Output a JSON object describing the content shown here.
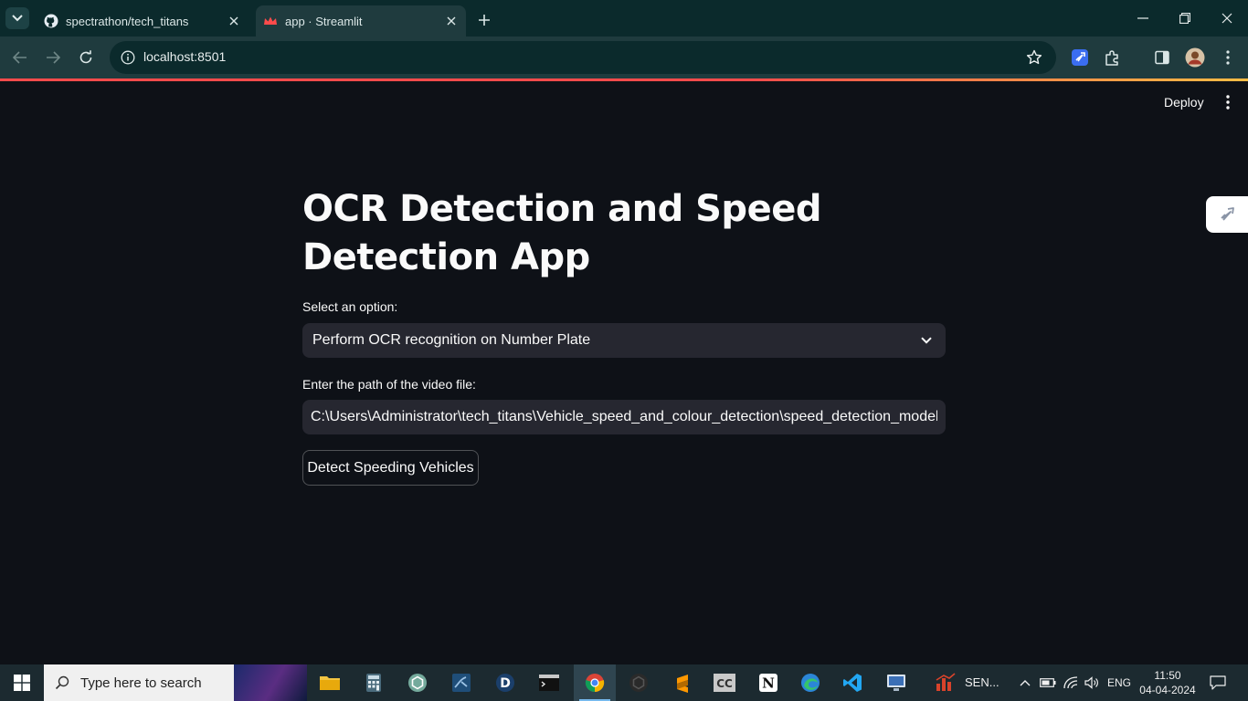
{
  "browser": {
    "tabs": [
      {
        "title": "spectrathon/tech_titans",
        "favicon": "github-icon",
        "active": false
      },
      {
        "title": "app · Streamlit",
        "favicon": "streamlit-icon",
        "active": true
      }
    ],
    "url": "localhost:8501"
  },
  "app": {
    "header": {
      "deploy_label": "Deploy"
    },
    "title": "OCR Detection and Speed Detection App",
    "select": {
      "label": "Select an option:",
      "value": "Perform OCR recognition on Number Plate"
    },
    "video_path": {
      "label": "Enter the path of the video file:",
      "value": "C:\\Users\\Administrator\\tech_titans\\Vehicle_speed_and_colour_detection\\speed_detection_model\\car"
    },
    "detect_button": "Detect Speeding Vehicles"
  },
  "taskbar": {
    "search_placeholder": "Type here to search",
    "pinned_label": "SEN...",
    "language": "ENG",
    "time": "11:50",
    "date": "04-04-2024"
  },
  "colors": {
    "tab_strip": "#0b2a2c",
    "toolbar": "#1f3b3e",
    "app_background": "#0e1117",
    "widget_background": "#262730",
    "accent": "#ff4b4b",
    "taskbar": "#1c2a30"
  }
}
